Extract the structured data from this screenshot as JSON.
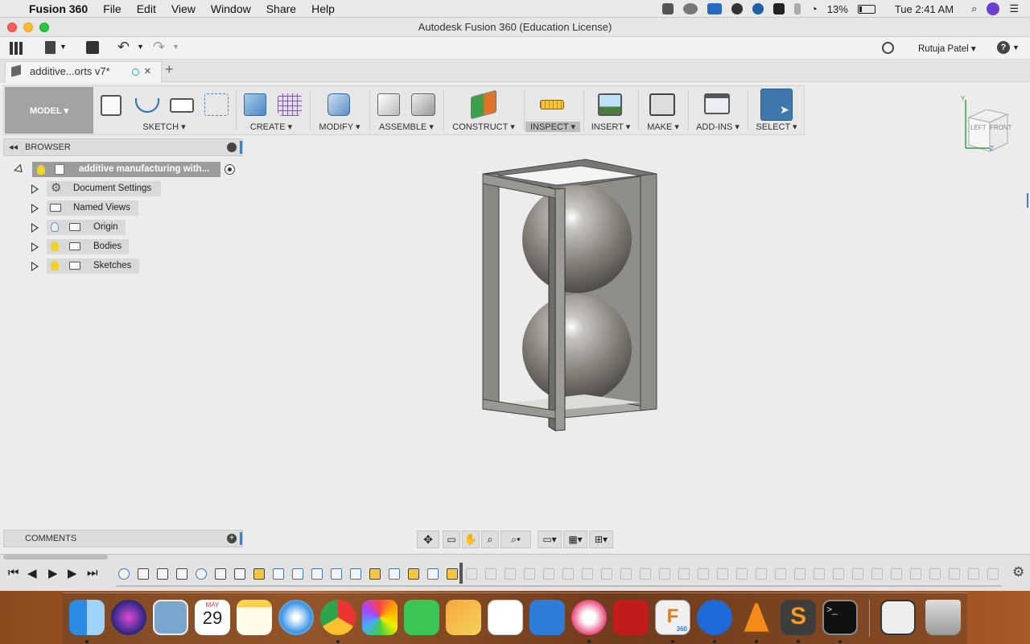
{
  "menubar": {
    "apple": "",
    "app": "Fusion 360",
    "items": [
      "File",
      "Edit",
      "View",
      "Window",
      "Share",
      "Help"
    ],
    "battery": "13%",
    "clock": "Tue 2:41 AM"
  },
  "window": {
    "title": "Autodesk Fusion 360 (Education License)"
  },
  "quickbar": {
    "user": "Rutuja Patel ▾",
    "help": "?"
  },
  "tab": {
    "label": "additive...orts v7*"
  },
  "ribbon": {
    "mode": "MODEL ▾",
    "groups": [
      "SKETCH ▾",
      "CREATE ▾",
      "MODIFY ▾",
      "ASSEMBLE ▾",
      "CONSTRUCT ▾",
      "INSPECT ▾",
      "INSERT ▾",
      "MAKE ▾",
      "ADD-INS ▾",
      "SELECT ▾"
    ]
  },
  "browser": {
    "title": "BROWSER",
    "root": "additive manufacturing with...",
    "items": [
      "Document Settings",
      "Named Views",
      "Origin",
      "Bodies",
      "Sketches"
    ]
  },
  "comments": {
    "title": "COMMENTS"
  },
  "viewcube": {
    "left": "LEFT",
    "front": "FRONT",
    "z": "Z",
    "y": "Y"
  },
  "dock": {
    "calendar_month": "MAY",
    "calendar_day": "29",
    "fusion_badge": "360"
  },
  "colors": {
    "accent": "#4b7fb3",
    "bulb_on": "#f2d22b",
    "bulb_off": "#8fb3d9"
  }
}
